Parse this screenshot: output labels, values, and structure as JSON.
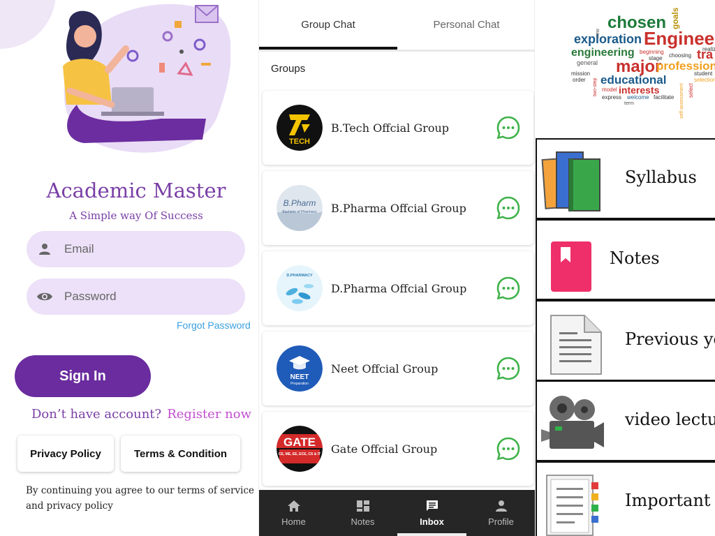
{
  "login": {
    "app_title": "Academic Master",
    "app_subtitle": "A Simple way Of Success",
    "email_placeholder": "Email",
    "password_placeholder": "Password",
    "forgot_password": "Forgot Password",
    "sign_in": "Sign In",
    "no_account": "Don’t have account?",
    "register_now": "Register now",
    "privacy_policy": "Privacy Policy",
    "terms_condition": "Terms & Condition",
    "terms_notice": "By continuing you agree to our terms of service and privacy policy",
    "colors": {
      "accent": "#6a2c9e",
      "field_bg": "#ece1f8",
      "link": "#3aa0e0"
    }
  },
  "inbox": {
    "tabs": [
      {
        "label": "Group Chat",
        "active": true
      },
      {
        "label": "Personal Chat",
        "active": false
      }
    ],
    "section_title": "Groups",
    "groups": [
      {
        "name": "B.Tech Offcial Group",
        "avatar_text": "TECH"
      },
      {
        "name": "B.Pharma Offcial Group",
        "avatar_text": "B.Pharm",
        "avatar_subtext": "Bachelor of Pharmacy"
      },
      {
        "name": "D.Pharma Offcial Group",
        "avatar_text": "D.PHARMACY"
      },
      {
        "name": "Neet  Offcial Group",
        "avatar_text": "NEET",
        "avatar_subtext": "Preparation"
      },
      {
        "name": "Gate  Offcial Group",
        "avatar_text": "GATE",
        "avatar_subtext": "CE, ME, EE, ECE, CS & IT"
      }
    ],
    "nav": [
      {
        "label": "Home",
        "icon": "home-icon"
      },
      {
        "label": "Notes",
        "icon": "dashboard-icon"
      },
      {
        "label": "Inbox",
        "icon": "message-icon",
        "active": true
      },
      {
        "label": "Profile",
        "icon": "person-icon"
      }
    ]
  },
  "menu": {
    "word_cloud": [
      "chosen",
      "goals",
      "Engineer",
      "exploration",
      "engineering",
      "major",
      "professional",
      "educational",
      "interests",
      "beginning",
      "stage",
      "choosing",
      "realizing",
      "general",
      "mission",
      "order",
      "model",
      "express",
      "welcome",
      "facilitate",
      "term",
      "student",
      "select",
      "selection",
      "self-assessment",
      "new",
      "two-step",
      "tra"
    ],
    "items": [
      {
        "label": "Syllabus",
        "icon": "books-icon"
      },
      {
        "label": "Notes",
        "icon": "bookmark-icon"
      },
      {
        "label": "Previous yea",
        "icon": "document-icon"
      },
      {
        "label": "video lecture",
        "icon": "video-camera-icon"
      },
      {
        "label": "Important qu",
        "icon": "tabbed-document-icon"
      }
    ]
  }
}
